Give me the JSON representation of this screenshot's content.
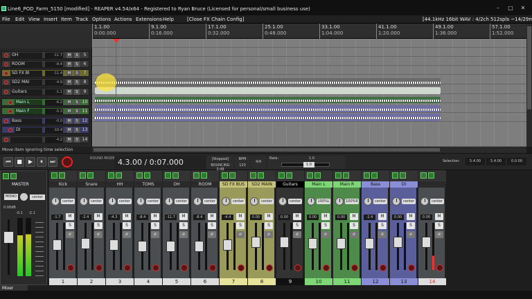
{
  "window": {
    "title": "Line6_POD_Farm_5150 [modified] - REAPER v4.54/x64 - Registered to Ryan Bruce (Licensed for personal/small business use)"
  },
  "menu": {
    "items": [
      "File",
      "Edit",
      "View",
      "Insert",
      "Item",
      "Track",
      "Options",
      "Actions",
      "Extensions",
      "Help",
      "[Close FX Chain Config]"
    ],
    "audio_info": "[44.1kHz 16bit WAV : 4/2ch 512spls ~14/29ms ASIO]"
  },
  "tcp": {
    "tracks": [
      {
        "name": "OH",
        "vol": "-11.7",
        "num": "5"
      },
      {
        "name": "ROOM",
        "vol": "-8.4",
        "num": "6"
      },
      {
        "name": "SD FX Bl",
        "vol": "-11.4",
        "num": "7"
      },
      {
        "name": "SD2 MAI",
        "vol": "-4.9",
        "num": "8"
      },
      {
        "name": "Guitars",
        "vol": "-1.1",
        "num": "9"
      },
      {
        "name": "Main L",
        "vol": "-6.2",
        "num": "10"
      },
      {
        "name": "Main F",
        "vol": "-5.3",
        "num": "11"
      },
      {
        "name": "Bass",
        "vol": "-0.0",
        "num": "12"
      },
      {
        "name": "DI",
        "vol": "-10.4",
        "num": "13"
      },
      {
        "name": "",
        "vol": "-4.2",
        "num": "14"
      }
    ],
    "buttons": {
      "mute": "M",
      "solo": "S"
    }
  },
  "ruler": [
    {
      "bar": "1.1.00",
      "time": "0:00.000"
    },
    {
      "bar": "9.1.00",
      "time": "0:16.000"
    },
    {
      "bar": "17.1.00",
      "time": "0:32.000"
    },
    {
      "bar": "25.1.00",
      "time": "0:48.000"
    },
    {
      "bar": "33.1.00",
      "time": "1:04.000"
    },
    {
      "bar": "41.1.00",
      "time": "1:20.000"
    },
    {
      "bar": "49.1.00",
      "time": "1:36.000"
    },
    {
      "bar": "57.1.00",
      "time": "1:52.000"
    }
  ],
  "hint": "Move item ignoring time selection",
  "transport": {
    "buttons": [
      "⏮",
      "■",
      "▶",
      "⏸",
      "⏭"
    ],
    "round_info": "ROUND MODE",
    "time": "4.3.00 / 0:07.000",
    "status": "[Stopped]",
    "bouncing": "BOUNCING 3:48",
    "bpm_label": "BPM",
    "bpm": "120",
    "sig": "4/4",
    "rate_label": "Rate:",
    "rate_val": "1.0",
    "rate_knob": "1.0",
    "sel_label": "Selection:",
    "sel_start": "5.4.00",
    "sel_end": "5.4.00",
    "sel_len": "0.0.00"
  },
  "mixer": {
    "master": {
      "label": "MASTER",
      "mono": "MONO",
      "pan": "center",
      "vol": "0.00dB",
      "peakL": "-0.1",
      "peakR": "-2.1"
    },
    "tab": "Mixer",
    "strips": [
      {
        "name": "Kick",
        "pan": "center",
        "vol": "-1.7",
        "num": "1",
        "type": ""
      },
      {
        "name": "Snare",
        "pan": "center",
        "vol": "-2.4",
        "num": "2",
        "type": ""
      },
      {
        "name": "HH",
        "pan": "center",
        "vol": "-4.3",
        "num": "3",
        "type": ""
      },
      {
        "name": "TOMS",
        "pan": "center",
        "vol": "-8.4",
        "num": "4",
        "type": ""
      },
      {
        "name": "OH",
        "pan": "center",
        "vol": "-11.7",
        "num": "5",
        "type": ""
      },
      {
        "name": "ROOM",
        "pan": "center",
        "vol": "-8.4",
        "num": "6",
        "type": ""
      },
      {
        "name": "SD FX BUS",
        "pan": "center",
        "vol": "-4.4",
        "num": "7",
        "type": "yellow"
      },
      {
        "name": "SD2 MAIN",
        "pan": "center",
        "vol": "0.00",
        "num": "8",
        "type": "yellow"
      },
      {
        "name": "Guitars",
        "pan": "center",
        "vol": "0.00",
        "num": "9",
        "type": "sel"
      },
      {
        "name": "Main L",
        "pan": "100%L",
        "vol": "0.00",
        "num": "10",
        "type": "green"
      },
      {
        "name": "Main R",
        "pan": "100%R",
        "vol": "0.00",
        "num": "11",
        "type": "green"
      },
      {
        "name": "Bass",
        "pan": "center",
        "vol": "-2.4",
        "num": "12",
        "type": "purple"
      },
      {
        "name": "DI",
        "pan": "center",
        "vol": "0.00",
        "num": "13",
        "type": "purple"
      },
      {
        "name": "",
        "pan": "center",
        "vol": "0.00",
        "num": "14",
        "type": "red"
      }
    ],
    "mute": "M",
    "solo": "S"
  }
}
